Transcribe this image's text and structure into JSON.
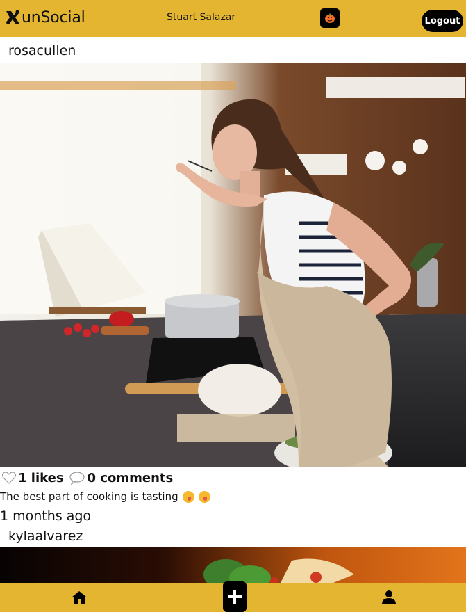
{
  "header": {
    "app_name": "unSocial",
    "user_name": "Stuart Salazar",
    "logout_label": "Logout",
    "theme_icon": "pumpkin-icon",
    "brand_color": "#e3b531"
  },
  "posts": [
    {
      "author": "rosacullen",
      "image": "woman-tasting-food-in-kitchen",
      "likes_text": "1 likes",
      "comments_text": "0 comments",
      "caption": "The best part of cooking is tasting",
      "caption_emojis": [
        "yum-emoji",
        "yum-emoji"
      ],
      "time_ago": "1 months ago"
    },
    {
      "author": "kylaalvarez",
      "image": "food-dish-on-dark-background"
    }
  ],
  "bottom_nav": {
    "items": [
      "home-icon",
      "add-icon",
      "profile-icon"
    ]
  }
}
